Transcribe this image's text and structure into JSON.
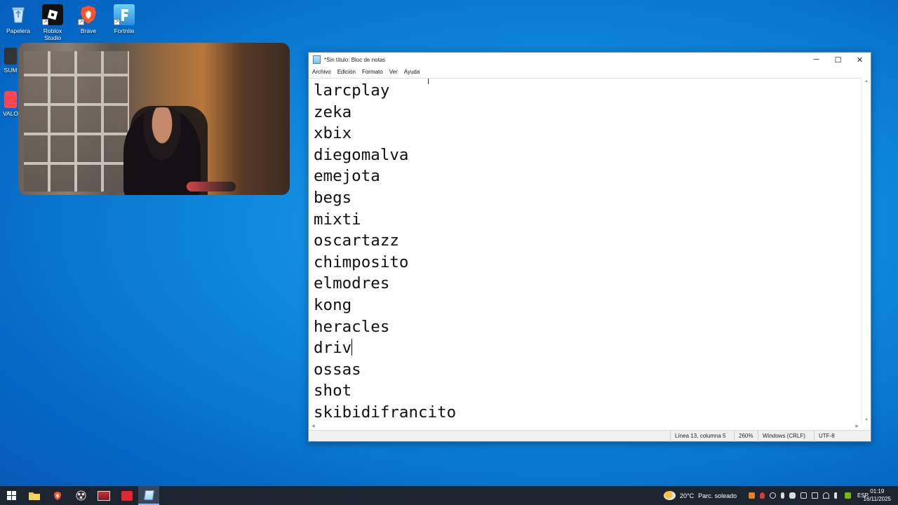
{
  "desktop": {
    "icons": [
      {
        "label": "Papelera",
        "icon": "recycle-bin-icon"
      },
      {
        "label": "Roblox Studio",
        "icon": "roblox-studio-icon"
      },
      {
        "label": "Brave",
        "icon": "brave-icon"
      },
      {
        "label": "Fortnite",
        "icon": "fortnite-icon"
      },
      {
        "label": "SUM",
        "icon": "sumo-icon"
      },
      {
        "label": "VALO",
        "icon": "valorant-icon"
      }
    ]
  },
  "notepad": {
    "title": "*Sin título: Bloc de notas",
    "controls": {
      "minimize": "─",
      "maximize": "☐",
      "close": "✕"
    },
    "menu": [
      "Archivo",
      "Edición",
      "Formato",
      "Ver",
      "Ayuda"
    ],
    "lines": [
      "larcplay",
      "zeka",
      "xbix",
      "diegomalva",
      "emejota",
      "begs",
      "mixti",
      "oscartazz",
      "chimposito",
      "elmodres",
      "kong",
      "heracles",
      "driv",
      "ossas",
      "shot",
      "skibidifrancito"
    ],
    "status": {
      "position": "Línea 13, columna 5",
      "zoom": "260%",
      "line_ending": "Windows (CRLF)",
      "encoding": "UTF-8"
    }
  },
  "taskbar": {
    "weather": {
      "temp": "20°C",
      "condition": "Parc. soleado"
    },
    "language": "ESP",
    "time": "01:19",
    "date": "16/11/2025",
    "apps": [
      "start-button",
      "file-explorer",
      "brave",
      "obs",
      "voicemeeter",
      "streamlabs",
      "notepad"
    ]
  },
  "colors": {
    "desktop": "#0e88dc",
    "taskbar": "#1c2430",
    "brave": "#fb542b",
    "roblox": "#111111"
  }
}
